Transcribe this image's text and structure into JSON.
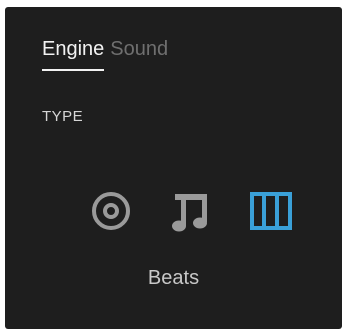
{
  "tabs": [
    {
      "label": "Engine",
      "active": true
    },
    {
      "label": "Sound",
      "active": false
    }
  ],
  "section": {
    "label": "TYPE"
  },
  "type_options": [
    {
      "icon": "circle-target-icon",
      "selected": false
    },
    {
      "icon": "music-note-icon",
      "selected": false
    },
    {
      "icon": "beats-grid-icon",
      "selected": true
    }
  ],
  "selected_type": "Beats",
  "colors": {
    "background": "#1e1e1e",
    "accent": "#3aa0d8",
    "icon_inactive": "#9a9a9a"
  }
}
